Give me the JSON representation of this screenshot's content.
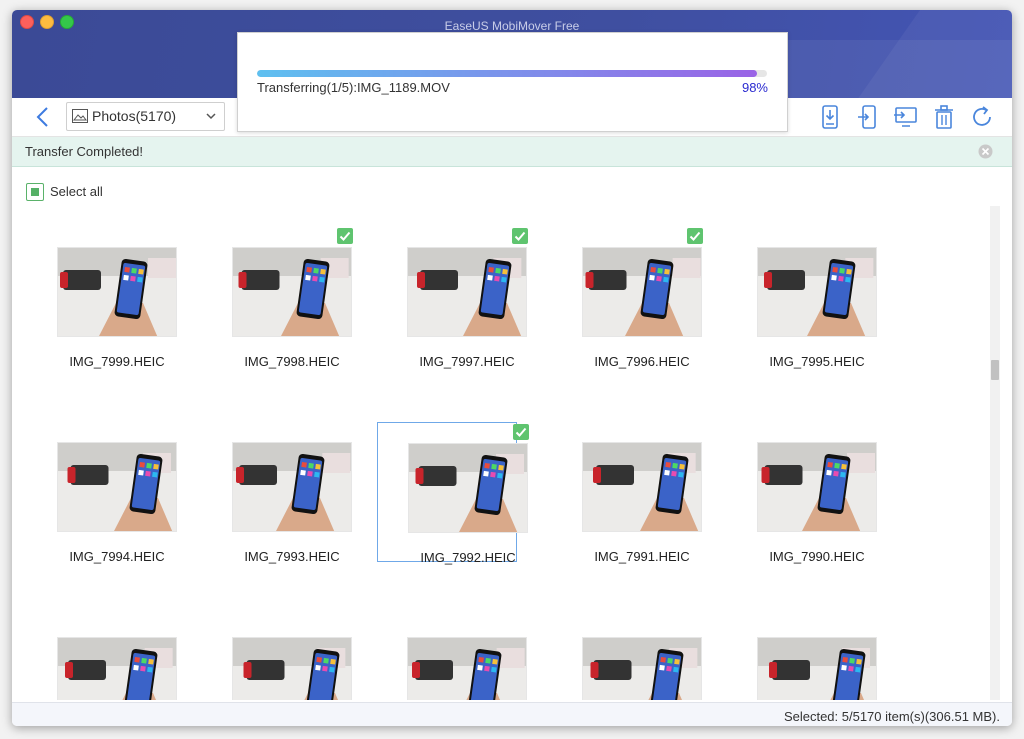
{
  "window": {
    "title": "EaseUS MobiMover Free"
  },
  "toolbar": {
    "album_select": "Photos(5170)",
    "actions": [
      "download-to-computer",
      "transfer-to-phone",
      "transfer-to-device",
      "delete",
      "refresh"
    ]
  },
  "banner": {
    "text": "Transfer Completed!"
  },
  "select_all": {
    "label": "Select all"
  },
  "transfer": {
    "status": "Transferring(1/5):IMG_1189.MOV",
    "percent_label": "98%",
    "progress": 0.98
  },
  "photos": [
    {
      "name": "IMG_7999.HEIC",
      "checked": false
    },
    {
      "name": "IMG_7998.HEIC",
      "checked": true
    },
    {
      "name": "IMG_7997.HEIC",
      "checked": true
    },
    {
      "name": "IMG_7996.HEIC",
      "checked": true
    },
    {
      "name": "IMG_7995.HEIC",
      "checked": false
    },
    {
      "name": "IMG_7994.HEIC",
      "checked": false
    },
    {
      "name": "IMG_7993.HEIC",
      "checked": false
    },
    {
      "name": "IMG_7992.HEIC",
      "checked": true
    },
    {
      "name": "IMG_7991.HEIC",
      "checked": false
    },
    {
      "name": "IMG_7990.HEIC",
      "checked": false
    },
    {
      "name": "",
      "checked": false
    },
    {
      "name": "",
      "checked": false
    },
    {
      "name": "",
      "checked": false
    },
    {
      "name": "",
      "checked": false
    },
    {
      "name": "",
      "checked": false
    }
  ],
  "status": {
    "text": "Selected: 5/5170 item(s)(306.51 MB)."
  },
  "colors": {
    "titlebar": "#3f4fa0",
    "accent": "#5b8ef0",
    "check": "#5fc46f",
    "banner_bg": "#e5f4ef"
  }
}
